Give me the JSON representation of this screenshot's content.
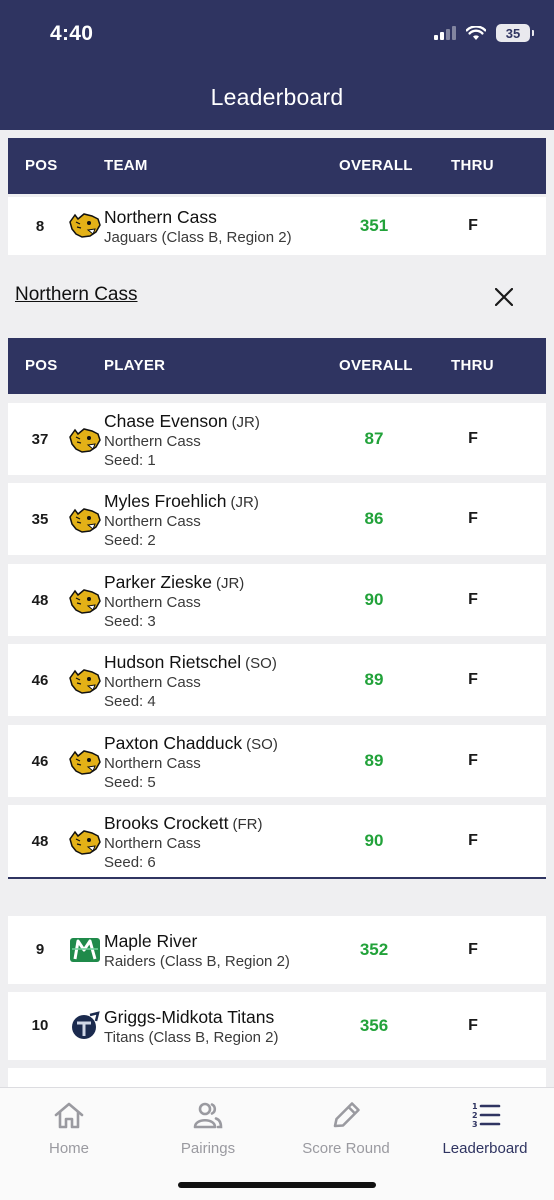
{
  "status": {
    "time": "4:40",
    "battery": "35"
  },
  "header": {
    "title": "Leaderboard"
  },
  "team_table": {
    "columns": {
      "pos": "POS",
      "team": "TEAM",
      "overall": "OVERALL",
      "thru": "THRU"
    }
  },
  "selected_team": {
    "pos": "8",
    "name": "Northern Cass",
    "sub": "Jaguars (Class B, Region 2)",
    "overall": "351",
    "thru": "F"
  },
  "team_detail": {
    "link": "Northern Cass"
  },
  "player_table": {
    "columns": {
      "pos": "POS",
      "player": "PLAYER",
      "overall": "OVERALL",
      "thru": "THRU"
    },
    "players": [
      {
        "pos": "37",
        "name": "Chase Evenson",
        "grade": "(JR)",
        "team": "Northern Cass",
        "seed": "Seed: 1",
        "overall": "87",
        "thru": "F"
      },
      {
        "pos": "35",
        "name": "Myles Froehlich",
        "grade": "(JR)",
        "team": "Northern Cass",
        "seed": "Seed: 2",
        "overall": "86",
        "thru": "F"
      },
      {
        "pos": "48",
        "name": "Parker Zieske",
        "grade": "(JR)",
        "team": "Northern Cass",
        "seed": "Seed: 3",
        "overall": "90",
        "thru": "F"
      },
      {
        "pos": "46",
        "name": "Hudson Rietschel",
        "grade": "(SO)",
        "team": "Northern Cass",
        "seed": "Seed: 4",
        "overall": "89",
        "thru": "F"
      },
      {
        "pos": "46",
        "name": "Paxton Chadduck",
        "grade": "(SO)",
        "team": "Northern Cass",
        "seed": "Seed: 5",
        "overall": "89",
        "thru": "F"
      },
      {
        "pos": "48",
        "name": "Brooks Crockett",
        "grade": "(FR)",
        "team": "Northern Cass",
        "seed": "Seed: 6",
        "overall": "90",
        "thru": "F"
      }
    ]
  },
  "other_teams": [
    {
      "pos": "9",
      "name": "Maple River",
      "sub": "Raiders (Class B, Region 2)",
      "overall": "352",
      "thru": "F"
    },
    {
      "pos": "10",
      "name": "Griggs-Midkota Titans",
      "sub": "Titans (Class B, Region 2)",
      "overall": "356",
      "thru": "F"
    }
  ],
  "tabs": [
    {
      "label": "Home",
      "icon": "home-icon"
    },
    {
      "label": "Pairings",
      "icon": "people-icon"
    },
    {
      "label": "Score Round",
      "icon": "pencil-icon"
    },
    {
      "label": "Leaderboard",
      "icon": "leaderboard-icon"
    }
  ],
  "colors": {
    "navy": "#2f3461",
    "score_green": "#22a23a",
    "background": "#efeff1"
  }
}
